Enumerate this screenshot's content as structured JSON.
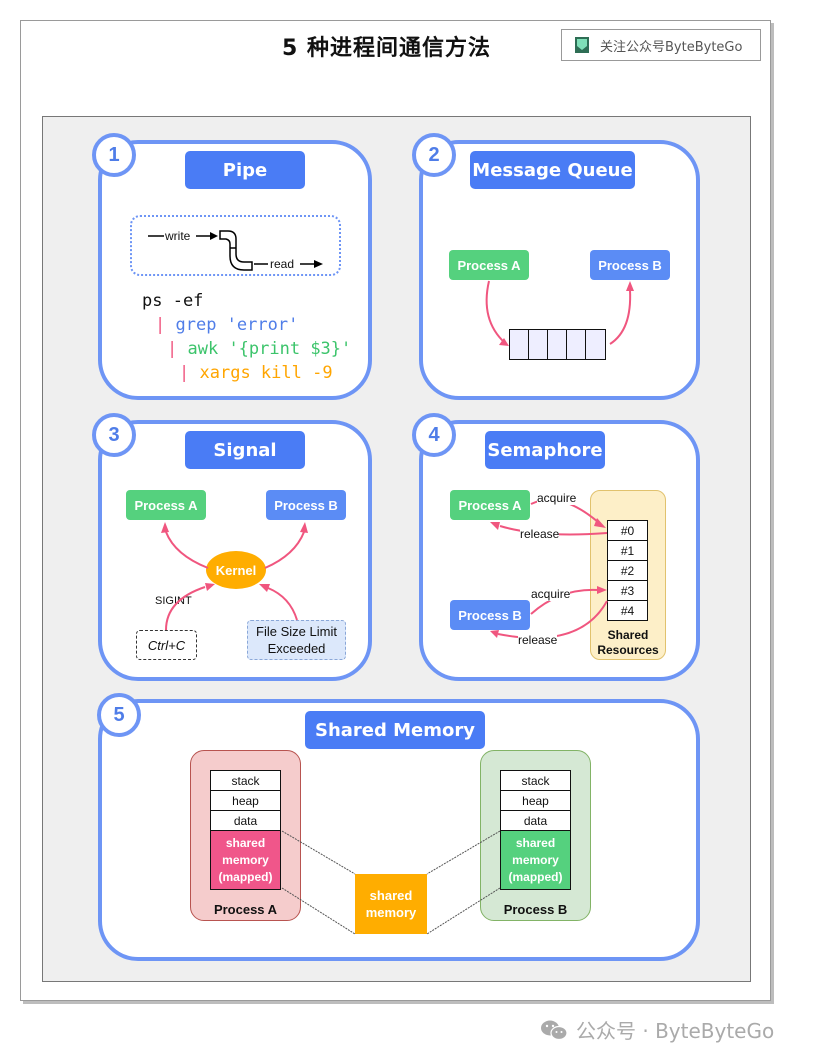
{
  "header": {
    "title": "5 种进程间通信方法",
    "follow_label": "关注公众号ByteByteGo",
    "follow_icon": "bytebytego-logo-icon"
  },
  "footer": {
    "text": "公众号 · ByteByteGo",
    "icon": "wechat-icon"
  },
  "colors": {
    "card_border": "#6e95f5",
    "title_bg": "#4a7cf5",
    "process_a": "#55d17e",
    "process_b": "#5b8cf5",
    "arrow": "#f0567f",
    "kernel": "#ffad00",
    "shared_mem": "#ffad00"
  },
  "sections": {
    "pipe": {
      "number": "1",
      "title": "Pipe",
      "write_label": "write",
      "read_label": "read",
      "commands": [
        {
          "prefix": "",
          "text": "ps -ef"
        },
        {
          "prefix": "|",
          "text": "grep 'error'"
        },
        {
          "prefix": "|",
          "text": "awk '{print $3}'"
        },
        {
          "prefix": "|",
          "text": "xargs kill -9"
        }
      ]
    },
    "message_queue": {
      "number": "2",
      "title": "Message Queue",
      "process_a": "Process A",
      "process_b": "Process B",
      "queue_slots": 5
    },
    "signal": {
      "number": "3",
      "title": "Signal",
      "process_a": "Process A",
      "process_b": "Process B",
      "kernel": "Kernel",
      "sigint": "SIGINT",
      "ctrl_c": "Ctrl+C",
      "file_limit": "File Size Limit Exceeded"
    },
    "semaphore": {
      "number": "4",
      "title": "Semaphore",
      "process_a": "Process A",
      "process_b": "Process B",
      "acquire": "acquire",
      "release": "release",
      "resources": [
        "#0",
        "#1",
        "#2",
        "#3",
        "#4"
      ],
      "resources_label": "Shared Resources"
    },
    "shared_memory": {
      "number": "5",
      "title": "Shared Memory",
      "segments": [
        "stack",
        "heap",
        "data"
      ],
      "mapped_label": "shared memory (mapped)",
      "process_a": "Process A",
      "process_b": "Process B",
      "shared_label": "shared memory"
    }
  }
}
